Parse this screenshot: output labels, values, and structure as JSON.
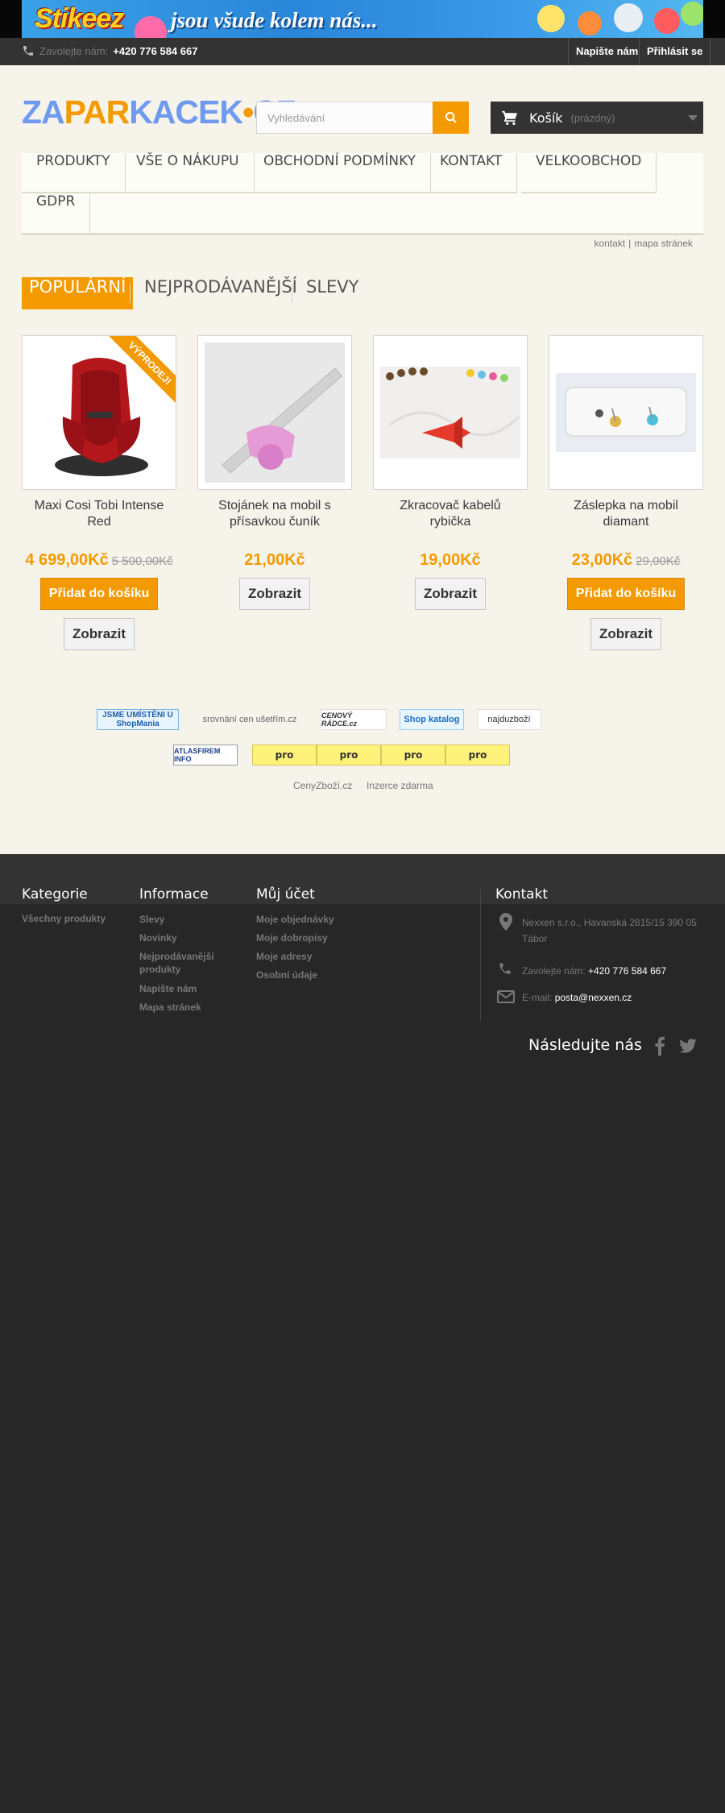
{
  "banner": {
    "logo": "Stikeez",
    "slogan": "jsou všude kolem nás..."
  },
  "topbar": {
    "phone_label": "Zavolejte nám:",
    "phone": "+420 776 584 667",
    "contact_link": "Napište nám",
    "login_link": "Přihlásit se"
  },
  "header": {
    "logo_parts": [
      "ZA",
      "PAR",
      "KACEK",
      "•",
      "CZ"
    ],
    "search_placeholder": "Vyhledávání",
    "cart_label": "Košík",
    "cart_status": "(prázdný)"
  },
  "menu": {
    "items": [
      "Produkty",
      "Vše o nákupu",
      "Obchodní podmínky",
      "Kontakt",
      "Velkoobchod",
      "GDPR"
    ]
  },
  "sublinks": [
    "kontakt",
    "mapa stránek"
  ],
  "tabs": [
    "Populární",
    "Nejprodávanější",
    "Slevy"
  ],
  "products": [
    {
      "name": "Maxi Cosi Tobi Intense Red",
      "price": "4 699,00Kč",
      "old_price": "5 500,00Kč",
      "badge": "Výprodej!",
      "add_label": "Přidat do košíku",
      "view_label": "Zobrazit"
    },
    {
      "name": "Stojánek na mobil s přísavkou čuník",
      "price": "21,00Kč",
      "view_label": "Zobrazit"
    },
    {
      "name": "Zkracovač kabelů rybička",
      "price": "19,00Kč",
      "view_label": "Zobrazit"
    },
    {
      "name": "Záslepka na mobil diamant",
      "price": "23,00Kč",
      "old_price": "29,00Kč",
      "add_label": "Přidat do košíku",
      "view_label": "Zobrazit"
    }
  ],
  "partners": {
    "shopmania": "JSME UMÍSTĚNI U ShopMania",
    "usetrim": "srovnání cen ušetřím.cz",
    "cenovy_radce": "CENOVÝ RÁDCE.cz",
    "shop_katalog": "Shop katalog",
    "najdu_zbozi": "najduzboží",
    "atlas": "ATLASFIREM INFO",
    "pro": [
      "pro",
      "pro",
      "pro",
      "pro"
    ],
    "links": [
      "CenyZboží.cz",
      "Inzerce zdarma"
    ]
  },
  "footer": {
    "categories_title": "Kategorie",
    "categories": [
      "Všechny produkty"
    ],
    "info_title": "Informace",
    "info": [
      "Slevy",
      "Novinky",
      "Nejprodávanější produkty",
      "Napište nám",
      "Mapa stránek"
    ],
    "account_title": "Můj účet",
    "account": [
      "Moje objednávky",
      "Moje dobropisy",
      "Moje adresy",
      "Osobní údaje"
    ],
    "contact_title": "Kontakt",
    "address": "Nexxen s.r.o., Havanská 2815/15 390 05 Tábor",
    "phone_label": "Zavolejte nám:",
    "phone": "+420 776 584 667",
    "email_label": "E-mail:",
    "email": "posta@nexxen.cz",
    "follow": "Následujte nás"
  },
  "colors": {
    "accent": "#f39a00",
    "dark": "#333333",
    "footer": "#272727",
    "background": "#f6f3ea"
  },
  "icons": [
    "phone-icon",
    "search-icon",
    "cart-icon",
    "map-marker-icon",
    "envelope-icon",
    "facebook-icon",
    "twitter-icon"
  ]
}
